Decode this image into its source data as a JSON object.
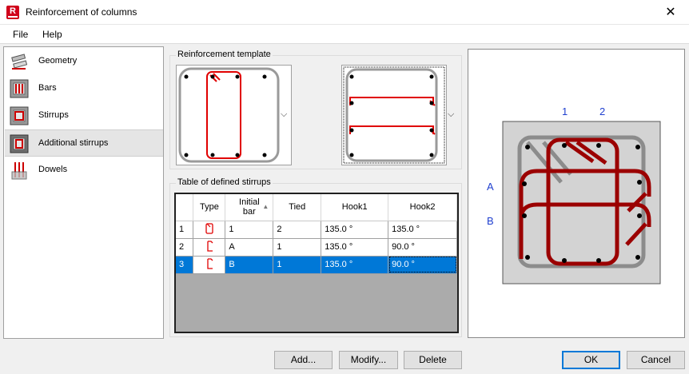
{
  "window": {
    "title": "Reinforcement of columns",
    "close_glyph": "✕",
    "app_icon_letter": "R"
  },
  "menu": [
    "File",
    "Help"
  ],
  "sidebar": {
    "items": [
      {
        "label": "Geometry",
        "icon": "geometry-icon"
      },
      {
        "label": "Bars",
        "icon": "bars-icon"
      },
      {
        "label": "Stirrups",
        "icon": "stirrups-icon"
      },
      {
        "label": "Additional stirrups",
        "icon": "additional-stirrups-icon",
        "selected": true
      },
      {
        "label": "Dowels",
        "icon": "dowels-icon"
      }
    ]
  },
  "template_group": {
    "title": "Reinforcement template",
    "arrow": "⌵"
  },
  "table_group": {
    "title": "Table of defined stirrups",
    "columns": [
      "",
      "Type",
      "Initial bar",
      "Tied",
      "Hook1",
      "Hook2"
    ],
    "sort_indicator": "▲",
    "rows": [
      {
        "index": "1",
        "type_icon": "closed-stirrup-icon",
        "initial_bar": "1",
        "tied": "2",
        "hook1": "135.0 °",
        "hook2": "135.0 °"
      },
      {
        "index": "2",
        "type_icon": "open-stirrup-icon",
        "initial_bar": "A",
        "tied": "1",
        "hook1": "135.0 °",
        "hook2": "90.0 °"
      },
      {
        "index": "3",
        "type_icon": "open-stirrup-icon",
        "initial_bar": "B",
        "tied": "1",
        "hook1": "135.0 °",
        "hook2": "90.0 °",
        "selected": true
      }
    ]
  },
  "preview": {
    "labels_top": [
      "1",
      "2"
    ],
    "labels_left": [
      "A",
      "B"
    ],
    "label_color": "#1f3fcf"
  },
  "buttons": {
    "add": "Add...",
    "modify": "Modify...",
    "delete": "Delete",
    "ok": "OK",
    "cancel": "Cancel"
  },
  "colors": {
    "selection": "#0078d7",
    "rebar_red": "#e00000",
    "rebar_dark_red": "#9b0000"
  }
}
